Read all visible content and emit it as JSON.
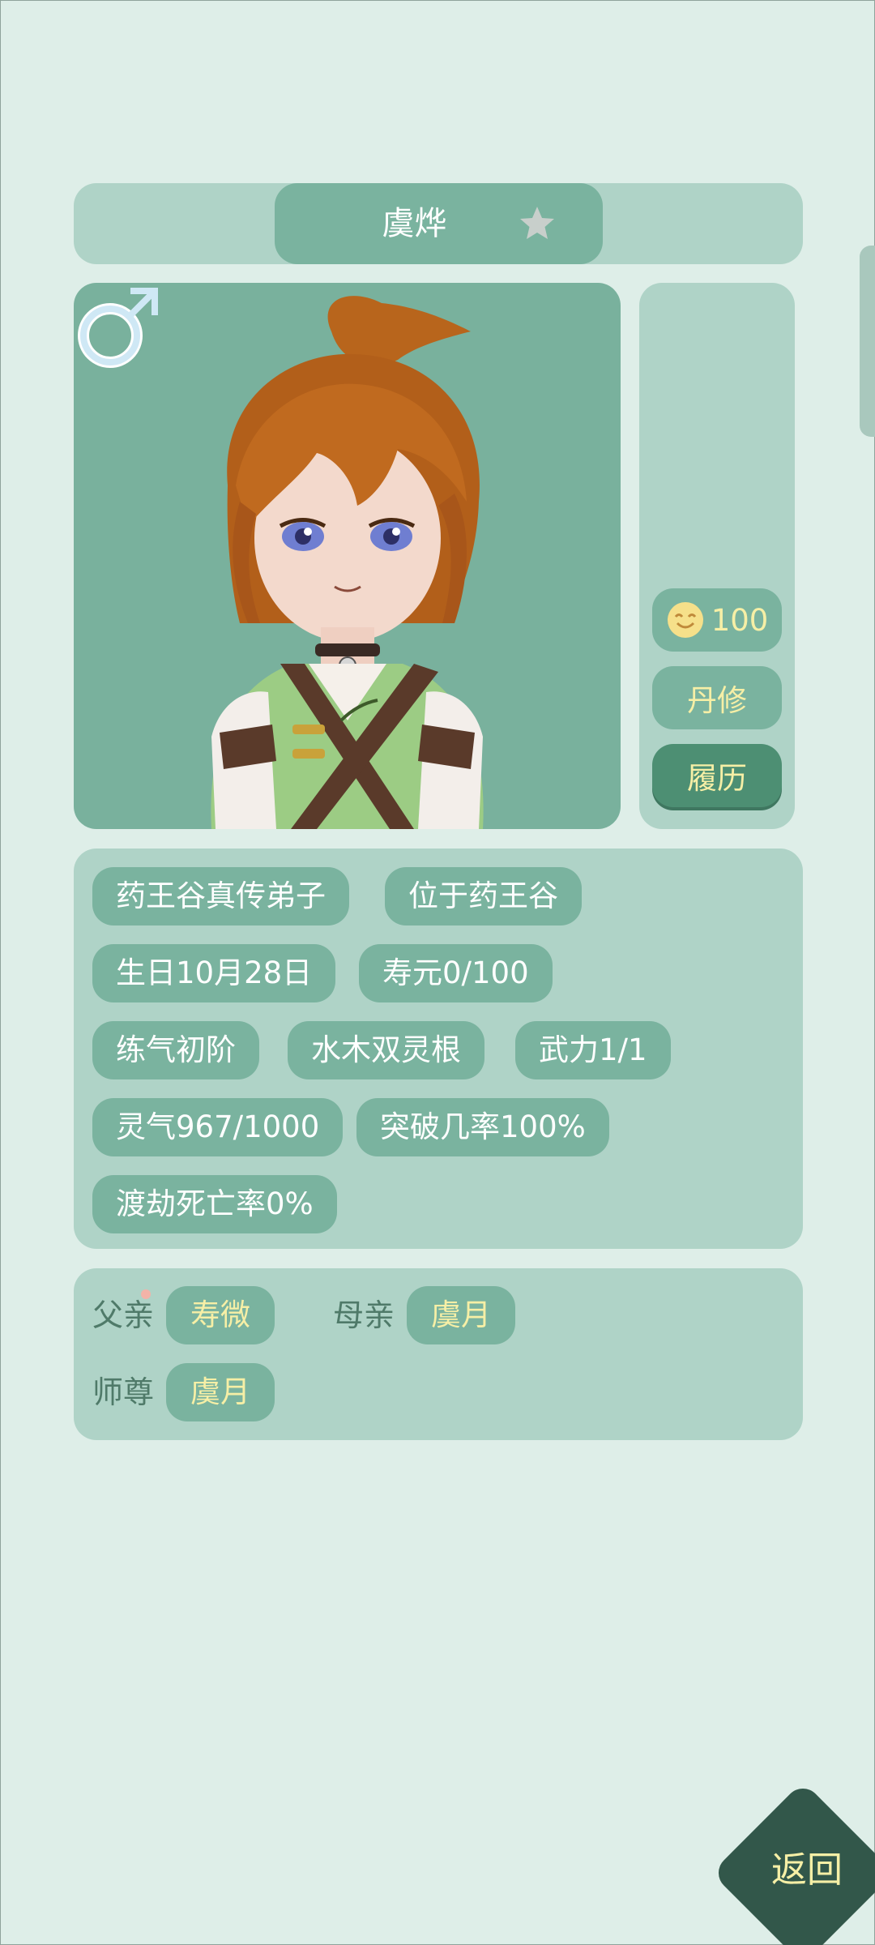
{
  "header": {
    "name": "虞烨",
    "favorite_icon": "star-icon"
  },
  "portrait": {
    "gender_icon": "male-symbol-icon"
  },
  "side_panel": {
    "mood_icon": "smiling-face-icon",
    "mood_value": "100",
    "alchemy_label": "丹修",
    "history_label": "履历"
  },
  "info": {
    "tags": [
      "药王谷真传弟子",
      "位于药王谷",
      "生日10月28日",
      "寿元0/100",
      "练气初阶",
      "水木双灵根",
      "武力1/1",
      "灵气967/1000",
      "突破几率100%",
      "渡劫死亡率0%"
    ]
  },
  "family": {
    "father_label": "父亲",
    "father_name": "寿微",
    "mother_label": "母亲",
    "mother_name": "虞月",
    "master_label": "师尊",
    "master_name": "虞月"
  },
  "back_label": "返回",
  "colors": {
    "background": "#deeee8",
    "panel": "#afd3c7",
    "chip": "#7ab39f",
    "accent_text": "#f6efa6",
    "dark_button": "#32574a"
  }
}
